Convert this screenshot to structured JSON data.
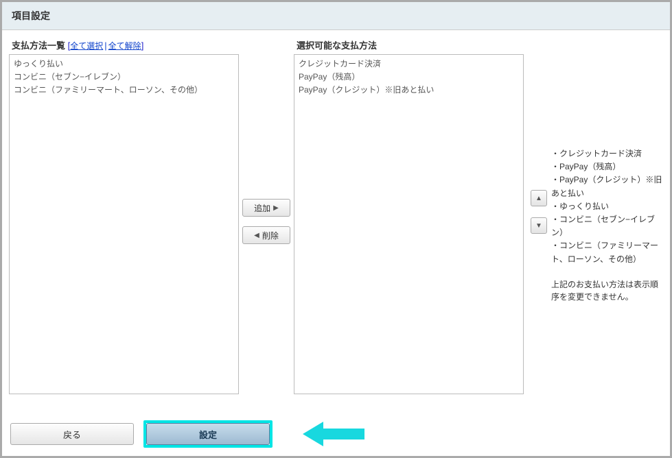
{
  "header": {
    "title": "項目設定"
  },
  "left_panel": {
    "title": "支払方法一覧",
    "select_all": "全て選択",
    "deselect_all": "全て解除",
    "items": [
      "ゆっくり払い",
      "コンビニ（セブン−イレブン）",
      "コンビニ（ファミリーマート、ローソン、その他）"
    ]
  },
  "mid_buttons": {
    "add": "追加",
    "remove": "削除"
  },
  "right_panel": {
    "title": "選択可能な支払方法",
    "items": [
      "クレジットカード決済",
      "PayPay（残高）",
      "PayPay（クレジット）※旧あと払い"
    ]
  },
  "side": {
    "fixed_items": [
      "・クレジットカード決済",
      "・PayPay（残高）",
      "・PayPay（クレジット）※旧あと払い",
      "・ゆっくり払い",
      "・コンビニ（セブン−イレブン）",
      "・コンビニ（ファミリーマート、ローソン、その他）"
    ],
    "note": "上記のお支払い方法は表示順序を変更できません。"
  },
  "footer": {
    "back": "戻る",
    "set": "設定"
  }
}
